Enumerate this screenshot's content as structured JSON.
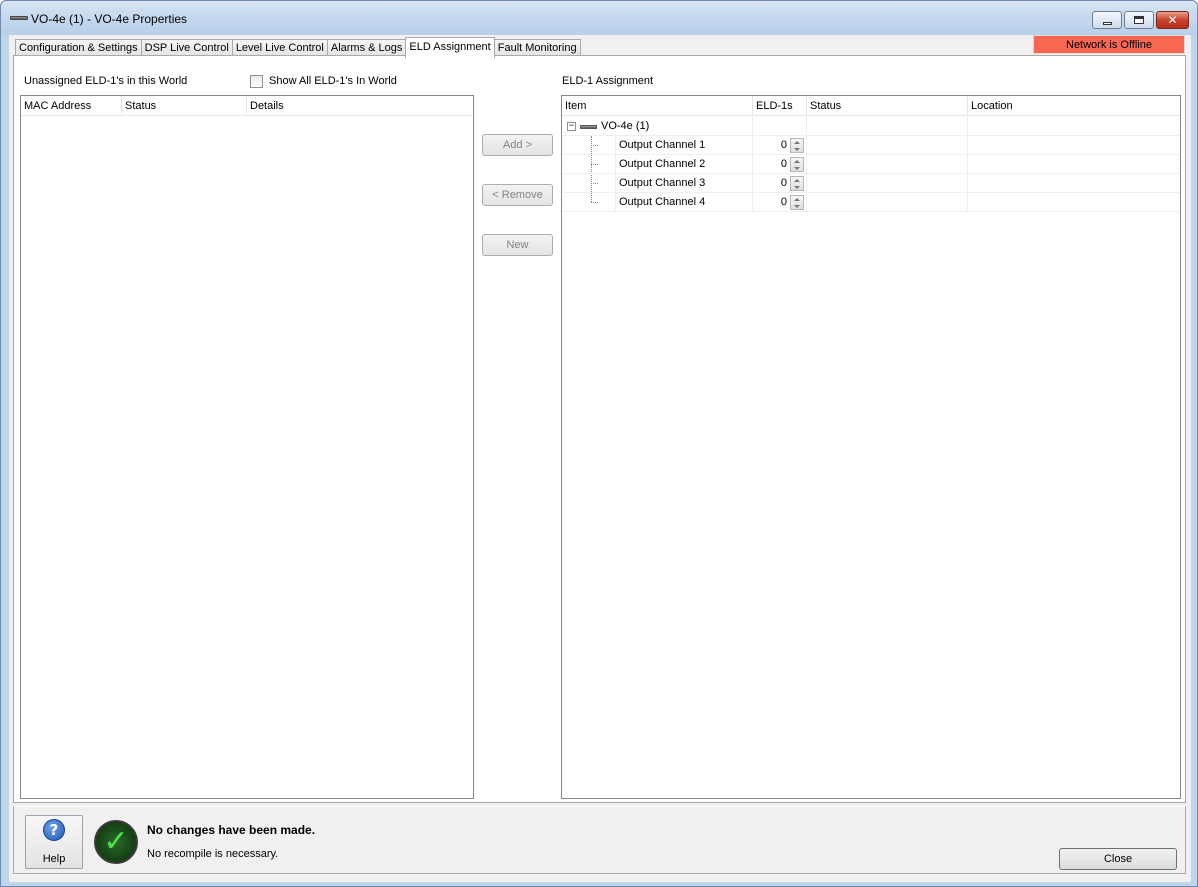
{
  "window": {
    "title": "VO-4e (1) - VO-4e Properties"
  },
  "tabs": [
    {
      "label": "Configuration & Settings"
    },
    {
      "label": "DSP Live Control"
    },
    {
      "label": "Level Live Control"
    },
    {
      "label": "Alarms & Logs"
    },
    {
      "label": "ELD Assignment",
      "active": true
    },
    {
      "label": "Fault Monitoring"
    }
  ],
  "network_status": {
    "label": "Network is Offline",
    "color": "#f96751"
  },
  "left_panel": {
    "title": "Unassigned ELD-1's in this World",
    "show_all_checkbox": {
      "label": "Show All ELD-1's In World",
      "checked": false
    },
    "columns": [
      "MAC Address",
      "Status",
      "Details"
    ]
  },
  "buttons": {
    "add": "Add >",
    "remove": "< Remove",
    "new": "New"
  },
  "right_panel": {
    "title": "ELD-1 Assignment",
    "columns": [
      "Item",
      "ELD-1s",
      "Status",
      "Location"
    ],
    "root": {
      "label": "VO-4e (1)",
      "expanded": true
    },
    "children": [
      {
        "label": "Output Channel 1",
        "eld_count": "0"
      },
      {
        "label": "Output Channel 2",
        "eld_count": "0"
      },
      {
        "label": "Output Channel 3",
        "eld_count": "0"
      },
      {
        "label": "Output Channel 4",
        "eld_count": "0"
      }
    ]
  },
  "footer": {
    "help_label": "Help",
    "message_title": "No changes have been made.",
    "message_sub": "No recompile is necessary.",
    "close_label": "Close"
  },
  "icons": {
    "help": "help-question-icon",
    "status": "green-checkmark-icon",
    "device": "device-icon"
  }
}
